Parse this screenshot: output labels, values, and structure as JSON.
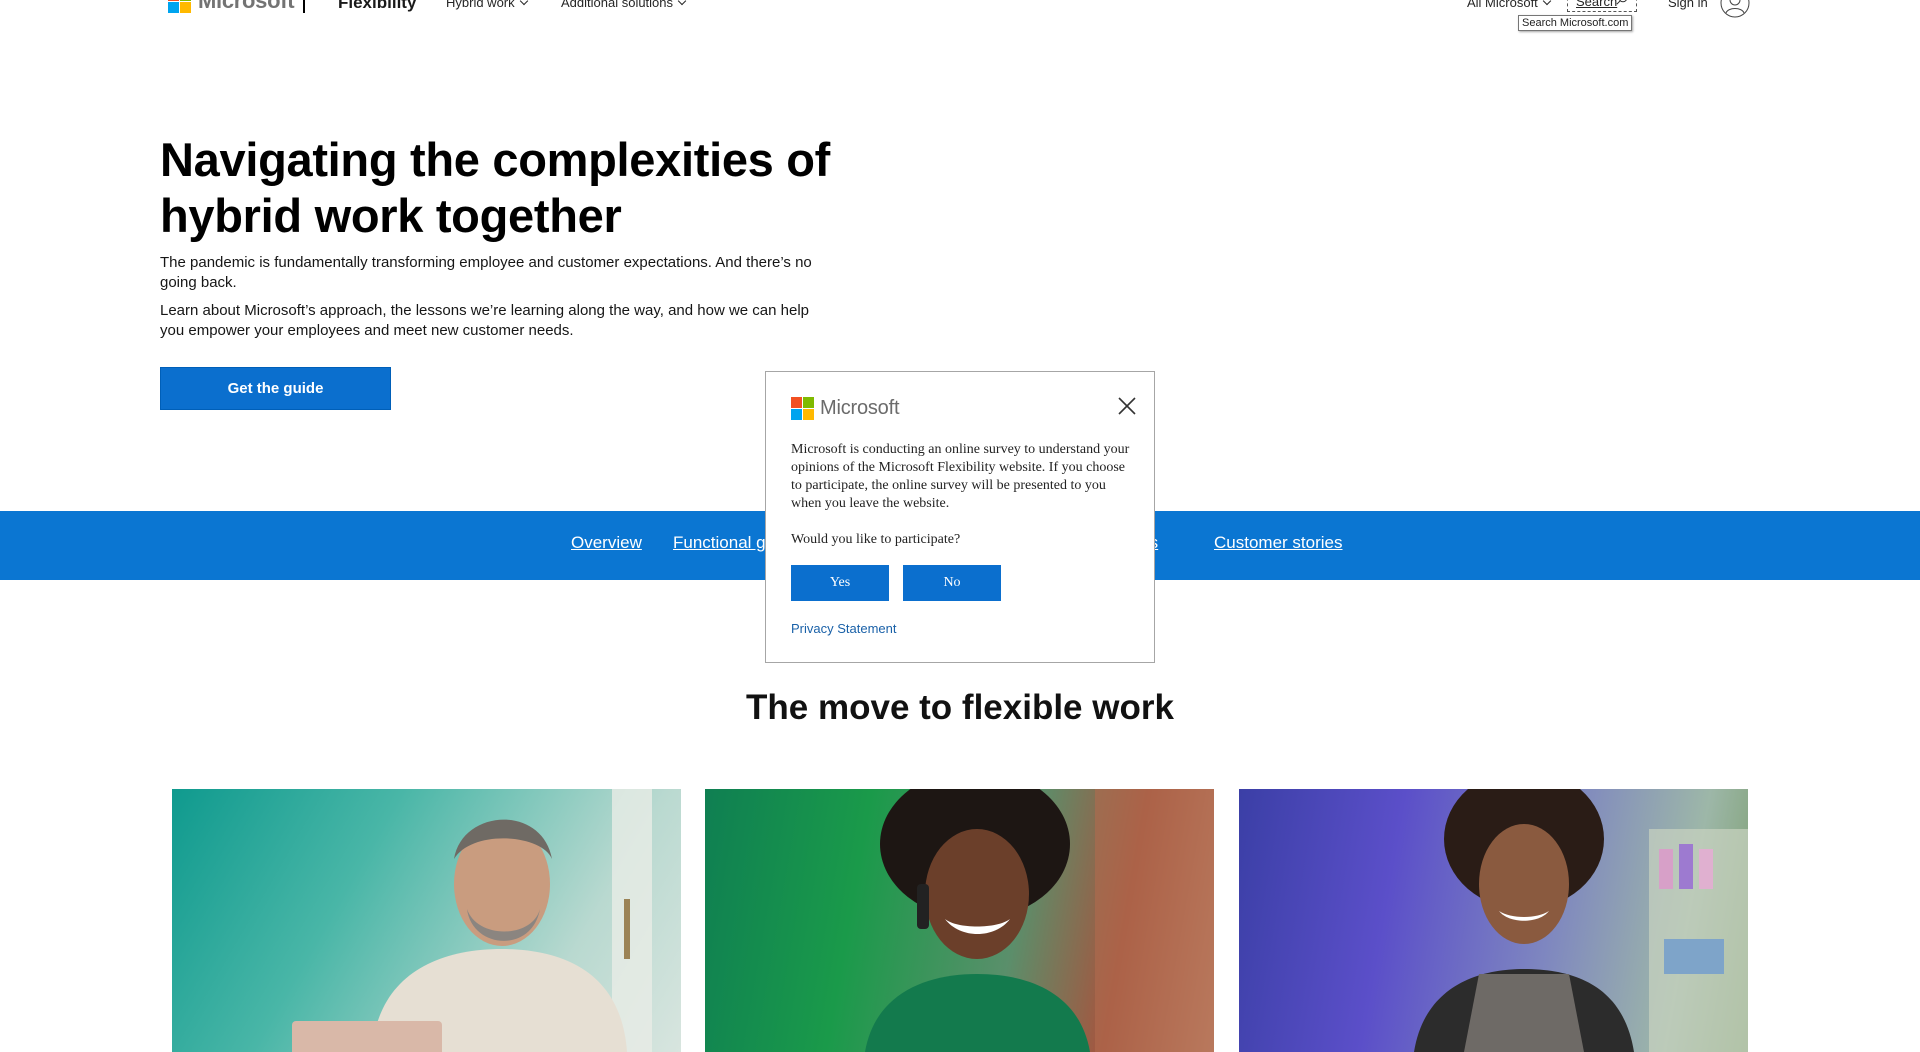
{
  "header": {
    "logo_text": "Microsoft",
    "brand": "Flexibility",
    "nav": [
      "Hybrid work",
      "Additional solutions"
    ],
    "all_microsoft": "All Microsoft",
    "search_label": "Search",
    "search_tooltip": "Search Microsoft.com",
    "sign_in": "Sign in"
  },
  "hero": {
    "title": "Navigating the complexities of hybrid work together",
    "paragraph1": "The pandemic is fundamentally transforming employee and customer expectations. And there’s no going back.",
    "paragraph2": "Learn about Microsoft’s approach, the lessons we’re learning along the way, and how we can help you empower your employees and meet new customer needs.",
    "cta": "Get the guide"
  },
  "subnav": {
    "items": [
      "Overview",
      "Functional g",
      "ides",
      "Customer stories"
    ]
  },
  "section": {
    "title": "The move to flexible work"
  },
  "survey": {
    "logo_text": "Microsoft",
    "message": "Microsoft is conducting an online survey to understand your opinions of the Microsoft Flexibility website. If you choose to participate, the online survey will be presented to you when you leave the website.",
    "question": "Would you like to participate?",
    "yes": "Yes",
    "no": "No",
    "privacy": "Privacy Statement"
  },
  "colors": {
    "ms_red": "#f25022",
    "ms_green": "#7fba00",
    "ms_blue": "#00a4ef",
    "ms_yellow": "#ffb900",
    "accent_blue": "#0b76d2",
    "button_blue": "#0b6fce"
  }
}
